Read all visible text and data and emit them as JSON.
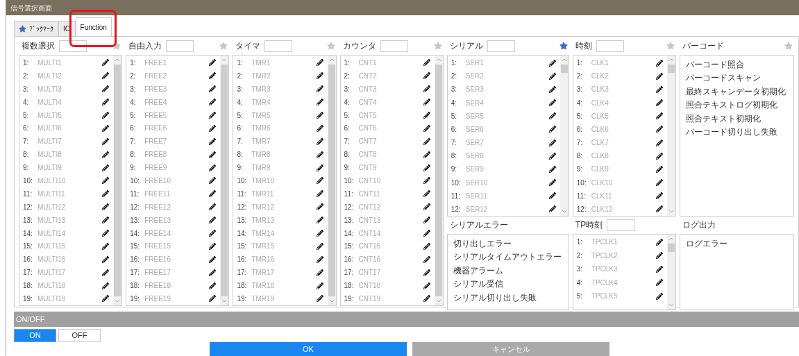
{
  "window": {
    "title": "信号選択画面"
  },
  "tabs": [
    {
      "label": "ﾌﾞｯｸﾏｰｸ",
      "kind": "bookmark",
      "selected": false
    },
    {
      "label": "IO",
      "kind": "plain",
      "selected": false
    },
    {
      "label": "Function",
      "kind": "plain",
      "selected": true
    }
  ],
  "columns": [
    {
      "sections": [
        {
          "title": "複数選択",
          "kind": "signals",
          "filter_field": true,
          "bookmarked": false,
          "items": [
            {
              "no": "1:",
              "name": "MULTI1"
            },
            {
              "no": "2:",
              "name": "MULTI2"
            },
            {
              "no": "3:",
              "name": "MULTI3"
            },
            {
              "no": "4:",
              "name": "MULTI4"
            },
            {
              "no": "5:",
              "name": "MULTI5"
            },
            {
              "no": "6:",
              "name": "MULTI6"
            },
            {
              "no": "7:",
              "name": "MULTI7"
            },
            {
              "no": "8:",
              "name": "MULTI8"
            },
            {
              "no": "9:",
              "name": "MULTI9"
            },
            {
              "no": "10:",
              "name": "MULTI10"
            },
            {
              "no": "11:",
              "name": "MULTI11"
            },
            {
              "no": "12:",
              "name": "MULTI12"
            },
            {
              "no": "13:",
              "name": "MULTI13"
            },
            {
              "no": "14:",
              "name": "MULTI14"
            },
            {
              "no": "15:",
              "name": "MULTI15"
            },
            {
              "no": "16:",
              "name": "MULTI16"
            },
            {
              "no": "17:",
              "name": "MULTI17"
            },
            {
              "no": "18:",
              "name": "MULTI18"
            },
            {
              "no": "19:",
              "name": "MULTI19"
            }
          ]
        }
      ]
    },
    {
      "sections": [
        {
          "title": "自由入力",
          "kind": "signals",
          "filter_field": true,
          "bookmarked": false,
          "items": [
            {
              "no": "1:",
              "name": "FREE1"
            },
            {
              "no": "2:",
              "name": "FREE2"
            },
            {
              "no": "3:",
              "name": "FREE3"
            },
            {
              "no": "4:",
              "name": "FREE4"
            },
            {
              "no": "5:",
              "name": "FREE5"
            },
            {
              "no": "6:",
              "name": "FREE6"
            },
            {
              "no": "7:",
              "name": "FREE7"
            },
            {
              "no": "8:",
              "name": "FREE8"
            },
            {
              "no": "9:",
              "name": "FREE9"
            },
            {
              "no": "10:",
              "name": "FREE10"
            },
            {
              "no": "11:",
              "name": "FREE11"
            },
            {
              "no": "12:",
              "name": "FREE12"
            },
            {
              "no": "13:",
              "name": "FREE13"
            },
            {
              "no": "14:",
              "name": "FREE14"
            },
            {
              "no": "15:",
              "name": "FREE15"
            },
            {
              "no": "16:",
              "name": "FREE16"
            },
            {
              "no": "17:",
              "name": "FREE17"
            },
            {
              "no": "18:",
              "name": "FREE18"
            },
            {
              "no": "19:",
              "name": "FREE19"
            }
          ]
        }
      ]
    },
    {
      "sections": [
        {
          "title": "タイマ",
          "kind": "signals",
          "filter_field": true,
          "bookmarked": false,
          "items": [
            {
              "no": "1:",
              "name": "TMR1"
            },
            {
              "no": "2:",
              "name": "TMR2"
            },
            {
              "no": "3:",
              "name": "TMR3"
            },
            {
              "no": "4:",
              "name": "TMR4"
            },
            {
              "no": "5:",
              "name": "TMR5"
            },
            {
              "no": "6:",
              "name": "TMR6"
            },
            {
              "no": "7:",
              "name": "TMR7"
            },
            {
              "no": "8:",
              "name": "TMR8"
            },
            {
              "no": "9:",
              "name": "TMR9"
            },
            {
              "no": "10:",
              "name": "TMR10"
            },
            {
              "no": "11:",
              "name": "TMR11"
            },
            {
              "no": "12:",
              "name": "TMR12"
            },
            {
              "no": "13:",
              "name": "TMR13"
            },
            {
              "no": "14:",
              "name": "TMR14"
            },
            {
              "no": "15:",
              "name": "TMR15"
            },
            {
              "no": "16:",
              "name": "TMR16"
            },
            {
              "no": "17:",
              "name": "TMR17"
            },
            {
              "no": "18:",
              "name": "TMR18"
            },
            {
              "no": "19:",
              "name": "TMR19"
            }
          ]
        }
      ]
    },
    {
      "sections": [
        {
          "title": "カウンタ",
          "kind": "signals",
          "filter_field": true,
          "bookmarked": false,
          "items": [
            {
              "no": "1:",
              "name": "CNT1"
            },
            {
              "no": "2:",
              "name": "CNT2"
            },
            {
              "no": "3:",
              "name": "CNT3"
            },
            {
              "no": "4:",
              "name": "CNT4"
            },
            {
              "no": "5:",
              "name": "CNT5"
            },
            {
              "no": "6:",
              "name": "CNT6"
            },
            {
              "no": "7:",
              "name": "CNT7"
            },
            {
              "no": "8:",
              "name": "CNT8"
            },
            {
              "no": "9:",
              "name": "CNT9"
            },
            {
              "no": "10:",
              "name": "CNT10"
            },
            {
              "no": "11:",
              "name": "CNT11"
            },
            {
              "no": "12:",
              "name": "CNT12"
            },
            {
              "no": "13:",
              "name": "CNT13"
            },
            {
              "no": "14:",
              "name": "CNT14"
            },
            {
              "no": "15:",
              "name": "CNT15"
            },
            {
              "no": "16:",
              "name": "CNT16"
            },
            {
              "no": "17:",
              "name": "CNT17"
            },
            {
              "no": "18:",
              "name": "CNT18"
            },
            {
              "no": "19:",
              "name": "CNT19"
            }
          ]
        }
      ]
    },
    {
      "sections": [
        {
          "title": "シリアル",
          "kind": "signals",
          "filter_field": true,
          "bookmarked": true,
          "items": [
            {
              "no": "1:",
              "name": "SER1"
            },
            {
              "no": "2:",
              "name": "SER2"
            },
            {
              "no": "3:",
              "name": "SER3"
            },
            {
              "no": "4:",
              "name": "SER4"
            },
            {
              "no": "5:",
              "name": "SER5"
            },
            {
              "no": "6:",
              "name": "SER6"
            },
            {
              "no": "7:",
              "name": "SER7"
            },
            {
              "no": "8:",
              "name": "SER8"
            },
            {
              "no": "9:",
              "name": "SER9"
            },
            {
              "no": "10:",
              "name": "SER10"
            },
            {
              "no": "11:",
              "name": "SER11"
            },
            {
              "no": "12:",
              "name": "SER12"
            }
          ]
        },
        {
          "title": "シリアルエラー",
          "kind": "actions",
          "items": [
            {
              "name": "切り出しエラー"
            },
            {
              "name": "シリアルタイムアウトエラー"
            },
            {
              "name": "機器アラーム"
            },
            {
              "name": "シリアル受信"
            },
            {
              "name": "シリアル切り出し失敗"
            }
          ]
        }
      ]
    },
    {
      "sections": [
        {
          "title": "時刻",
          "kind": "signals",
          "filter_field": true,
          "bookmarked": false,
          "items": [
            {
              "no": "1:",
              "name": "CLK1"
            },
            {
              "no": "2:",
              "name": "CLK2"
            },
            {
              "no": "3:",
              "name": "CLK3"
            },
            {
              "no": "4:",
              "name": "CLK4"
            },
            {
              "no": "5:",
              "name": "CLK5"
            },
            {
              "no": "6:",
              "name": "CLK6"
            },
            {
              "no": "7:",
              "name": "CLK7"
            },
            {
              "no": "8:",
              "name": "CLK8"
            },
            {
              "no": "9:",
              "name": "CLK9"
            },
            {
              "no": "10:",
              "name": "CLK10"
            },
            {
              "no": "11:",
              "name": "CLK11"
            },
            {
              "no": "12:",
              "name": "CLK12"
            }
          ]
        },
        {
          "title": "TP時刻",
          "kind": "signals",
          "filter_field": true,
          "items": [
            {
              "no": "1:",
              "name": "TPCLK1"
            },
            {
              "no": "2:",
              "name": "TPCLK2"
            },
            {
              "no": "3:",
              "name": "TPCLK3"
            },
            {
              "no": "4:",
              "name": "TPCLK4"
            },
            {
              "no": "5:",
              "name": "TPCLK5"
            }
          ]
        }
      ]
    },
    {
      "sections": [
        {
          "title": "バーコード",
          "kind": "actions",
          "bookmarked": false,
          "items": [
            {
              "name": "バーコード照合"
            },
            {
              "name": "バーコードスキャン"
            },
            {
              "name": "最終スキャンデータ初期化"
            },
            {
              "name": "照合テキストログ初期化"
            },
            {
              "name": "照合テキスト初期化"
            },
            {
              "name": "バーコード切り出し失敗"
            }
          ]
        },
        {
          "title": "ログ出力",
          "kind": "actions",
          "items": [
            {
              "name": "ログエラー"
            }
          ]
        }
      ]
    }
  ],
  "switch_bar": {
    "title": "ON/OFF",
    "options": [
      {
        "label": "ON",
        "selected": true
      },
      {
        "label": "OFF",
        "selected": false
      }
    ]
  },
  "buttons": [
    {
      "label": "OK",
      "kind": "primary"
    },
    {
      "label": "キャンセル",
      "kind": "disabled"
    }
  ]
}
